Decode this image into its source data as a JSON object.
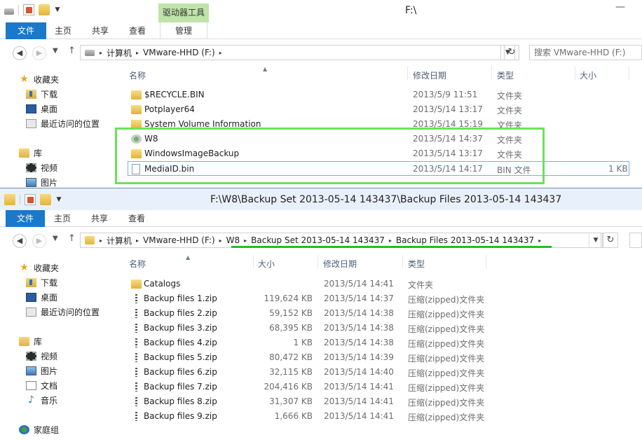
{
  "win1": {
    "title": "F:\\",
    "context_tab": "驱动器工具",
    "ribbon_tabs": [
      "文件",
      "主页",
      "共享",
      "查看",
      "管理"
    ],
    "breadcrumb": [
      "计算机",
      "VMware-HHD (F:)"
    ],
    "search_placeholder": "搜索 VMware-HHD (F:)",
    "sidebar": {
      "favorites": "收藏夹",
      "downloads": "下载",
      "desktop": "桌面",
      "recent": "最近访问的位置",
      "libraries": "库",
      "videos": "视频",
      "pictures": "图片"
    },
    "columns": {
      "name": "名称",
      "date": "修改日期",
      "type": "类型",
      "size": "大小"
    },
    "rows": [
      {
        "name": "$RECYCLE.BIN",
        "date": "2013/5/9 11:51",
        "type": "文件夹",
        "size": ""
      },
      {
        "name": "Potplayer64",
        "date": "2013/5/14 13:17",
        "type": "文件夹",
        "size": ""
      },
      {
        "name": "System Volume Information",
        "date": "2013/5/14 15:19",
        "type": "文件夹",
        "size": ""
      },
      {
        "name": "W8",
        "date": "2013/5/14 14:37",
        "type": "文件夹",
        "size": ""
      },
      {
        "name": "WindowsImageBackup",
        "date": "2013/5/14 13:17",
        "type": "文件夹",
        "size": ""
      },
      {
        "name": "MediaID.bin",
        "date": "2013/5/14 14:17",
        "type": "BIN 文件",
        "size": "1 KB"
      }
    ]
  },
  "win2": {
    "title": "F:\\W8\\Backup Set 2013-05-14 143437\\Backup Files 2013-05-14 143437",
    "ribbon_tabs": [
      "文件",
      "主页",
      "共享",
      "查看"
    ],
    "breadcrumb": [
      "计算机",
      "VMware-HHD (F:)",
      "W8",
      "Backup Set 2013-05-14 143437",
      "Backup Files 2013-05-14 143437"
    ],
    "sidebar": {
      "favorites": "收藏夹",
      "downloads": "下载",
      "desktop": "桌面",
      "recent": "最近访问的位置",
      "libraries": "库",
      "videos": "视频",
      "pictures": "图片",
      "documents": "文档",
      "music": "音乐",
      "homegroup": "家庭组"
    },
    "columns": {
      "name": "名称",
      "size": "大小",
      "date": "修改日期",
      "type": "类型"
    },
    "rows": [
      {
        "name": "Catalogs",
        "size": "",
        "date": "2013/5/14 14:41",
        "type": "文件夹"
      },
      {
        "name": "Backup files 1.zip",
        "size": "119,624 KB",
        "date": "2013/5/14 14:37",
        "type": "压缩(zipped)文件夹"
      },
      {
        "name": "Backup files 2.zip",
        "size": "59,152 KB",
        "date": "2013/5/14 14:38",
        "type": "压缩(zipped)文件夹"
      },
      {
        "name": "Backup files 3.zip",
        "size": "68,395 KB",
        "date": "2013/5/14 14:38",
        "type": "压缩(zipped)文件夹"
      },
      {
        "name": "Backup files 4.zip",
        "size": "1 KB",
        "date": "2013/5/14 14:38",
        "type": "压缩(zipped)文件夹"
      },
      {
        "name": "Backup files 5.zip",
        "size": "80,472 KB",
        "date": "2013/5/14 14:39",
        "type": "压缩(zipped)文件夹"
      },
      {
        "name": "Backup files 6.zip",
        "size": "32,115 KB",
        "date": "2013/5/14 14:40",
        "type": "压缩(zipped)文件夹"
      },
      {
        "name": "Backup files 7.zip",
        "size": "204,416 KB",
        "date": "2013/5/14 14:41",
        "type": "压缩(zipped)文件夹"
      },
      {
        "name": "Backup files 8.zip",
        "size": "31,307 KB",
        "date": "2013/5/14 14:41",
        "type": "压缩(zipped)文件夹"
      },
      {
        "name": "Backup files 9.zip",
        "size": "1,666 KB",
        "date": "2013/5/14 14:41",
        "type": "压缩(zipped)文件夹"
      }
    ]
  },
  "colors": {
    "file_tab": "#1979ca",
    "context_tab": "#bfe3a8",
    "highlight": "#6ee05a",
    "title_bar_2": "#e8f1fb"
  }
}
